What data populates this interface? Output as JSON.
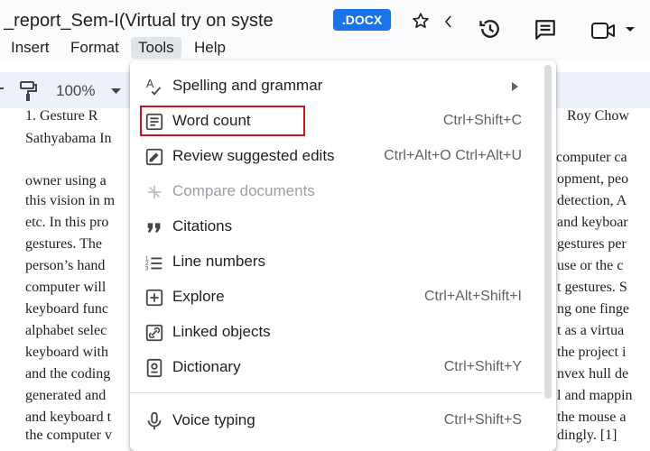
{
  "header": {
    "doc_title": "_report_Sem-I(Virtual try on syste",
    "file_badge": ".DOCX",
    "icons": [
      "star-icon",
      "history-icon",
      "comment-icon",
      "video-call-icon"
    ]
  },
  "menubar": {
    "items": [
      "Insert",
      "Format",
      "Tools",
      "Help"
    ],
    "active": "Tools"
  },
  "toolbar": {
    "zoom": "100%",
    "icons": [
      "paint-format-icon",
      "chevron-down-icon"
    ]
  },
  "document": {
    "lines": [
      {
        "left": "1.    Gesture   R",
        "right": "Roy   Chow"
      },
      {
        "left": "Sathyabama In",
        "right": ""
      },
      {
        "left": "",
        "right": ""
      },
      {
        "left": "owner using a",
        "right": "computer ca"
      },
      {
        "left": "this vision in m",
        "right": "opment, peo"
      },
      {
        "left": "etc. In this pro",
        "right": "detection, A"
      },
      {
        "left": "gestures.  The",
        "right": "and keyboar"
      },
      {
        "left": "person’s hand",
        "right": "gestures per"
      },
      {
        "left": "computer  will",
        "right": "use or the c"
      },
      {
        "left": "keyboard func",
        "right": "t  gestures.  S"
      },
      {
        "left": "alphabet selec",
        "right": "ng one finge"
      },
      {
        "left": "keyboard with",
        "right": "t as a virtua"
      },
      {
        "left": "and the coding",
        "right": "the project i"
      },
      {
        "left": "generated and",
        "right": "nvex hull de"
      },
      {
        "left": "and keyboard t",
        "right": "l and mappin"
      },
      {
        "left": "the computer v",
        "right": "the mouse a"
      },
      {
        "left": "",
        "right": "dingly. [1]"
      }
    ]
  },
  "tools_menu": {
    "items": [
      {
        "label": "Spelling and grammar",
        "shortcut": "",
        "icon": "spellcheck-icon",
        "submenu": true,
        "disabled": false
      },
      {
        "label": "Word count",
        "shortcut": "Ctrl+Shift+C",
        "icon": "word-count-icon",
        "submenu": false,
        "disabled": false,
        "highlighted": true
      },
      {
        "label": "Review suggested edits",
        "shortcut": "Ctrl+Alt+O Ctrl+Alt+U",
        "icon": "review-edits-icon",
        "submenu": false,
        "disabled": false
      },
      {
        "label": "Compare documents",
        "shortcut": "",
        "icon": "compare-icon",
        "submenu": false,
        "disabled": true
      },
      {
        "label": "Citations",
        "shortcut": "",
        "icon": "quote-icon",
        "submenu": false,
        "disabled": false
      },
      {
        "label": "Line numbers",
        "shortcut": "",
        "icon": "line-numbers-icon",
        "submenu": false,
        "disabled": false
      },
      {
        "label": "Explore",
        "shortcut": "Ctrl+Alt+Shift+I",
        "icon": "explore-icon",
        "submenu": false,
        "disabled": false
      },
      {
        "label": "Linked objects",
        "shortcut": "",
        "icon": "link-icon",
        "submenu": false,
        "disabled": false
      },
      {
        "label": "Dictionary",
        "shortcut": "Ctrl+Shift+Y",
        "icon": "dictionary-icon",
        "submenu": false,
        "disabled": false
      },
      {
        "label": "Voice typing",
        "shortcut": "Ctrl+Shift+S",
        "icon": "microphone-icon",
        "submenu": false,
        "disabled": false
      }
    ]
  },
  "colors": {
    "accent": "#1a73e8",
    "highlight_box": "#d0101a",
    "header_bg": "#f9fbfd",
    "toolbar_bg": "#edf2fa"
  }
}
